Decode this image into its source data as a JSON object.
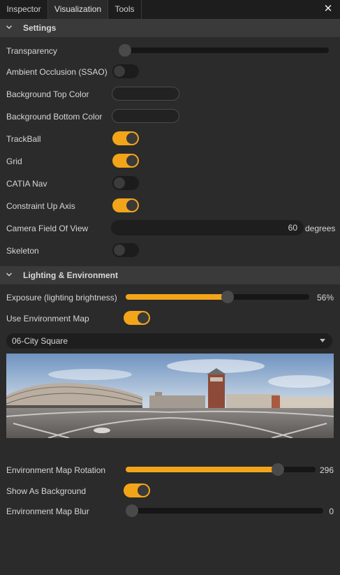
{
  "tabs": [
    {
      "label": "Inspector",
      "active": false
    },
    {
      "label": "Visualization",
      "active": true
    },
    {
      "label": "Tools",
      "active": false
    }
  ],
  "close_icon": "close-icon",
  "settings": {
    "title": "Settings",
    "transparency": {
      "label": "Transparency",
      "value": 0
    },
    "ssao": {
      "label": "Ambient Occlusion (SSAO)",
      "on": false
    },
    "bg_top": {
      "label": "Background Top Color"
    },
    "bg_bottom": {
      "label": "Background Bottom Color"
    },
    "trackball": {
      "label": "TrackBall",
      "on": true
    },
    "grid": {
      "label": "Grid",
      "on": true
    },
    "catia": {
      "label": "CATIA Nav",
      "on": false
    },
    "constraint": {
      "label": "Constraint Up Axis",
      "on": true
    },
    "fov": {
      "label": "Camera Field Of View",
      "value": "60",
      "unit": "degrees"
    },
    "skeleton": {
      "label": "Skeleton",
      "on": false
    }
  },
  "lighting": {
    "title": "Lighting & Environment",
    "exposure": {
      "label": "Exposure (lighting brightness)",
      "fraction": 0.56,
      "value_text": "56%"
    },
    "env_map": {
      "label": "Use Environment Map",
      "on": true
    },
    "env_select": {
      "value": "06-City Square"
    },
    "rotation": {
      "label": "Environment Map Rotation",
      "fraction": 0.822,
      "value_text": "296"
    },
    "show_bg": {
      "label": "Show As Background",
      "on": true
    },
    "blur": {
      "label": "Environment Map Blur",
      "fraction": 0.0,
      "value_text": "0"
    }
  },
  "colors": {
    "accent": "#f3a51a",
    "panel": "#2b2b2b",
    "section": "#3a3a3a"
  }
}
